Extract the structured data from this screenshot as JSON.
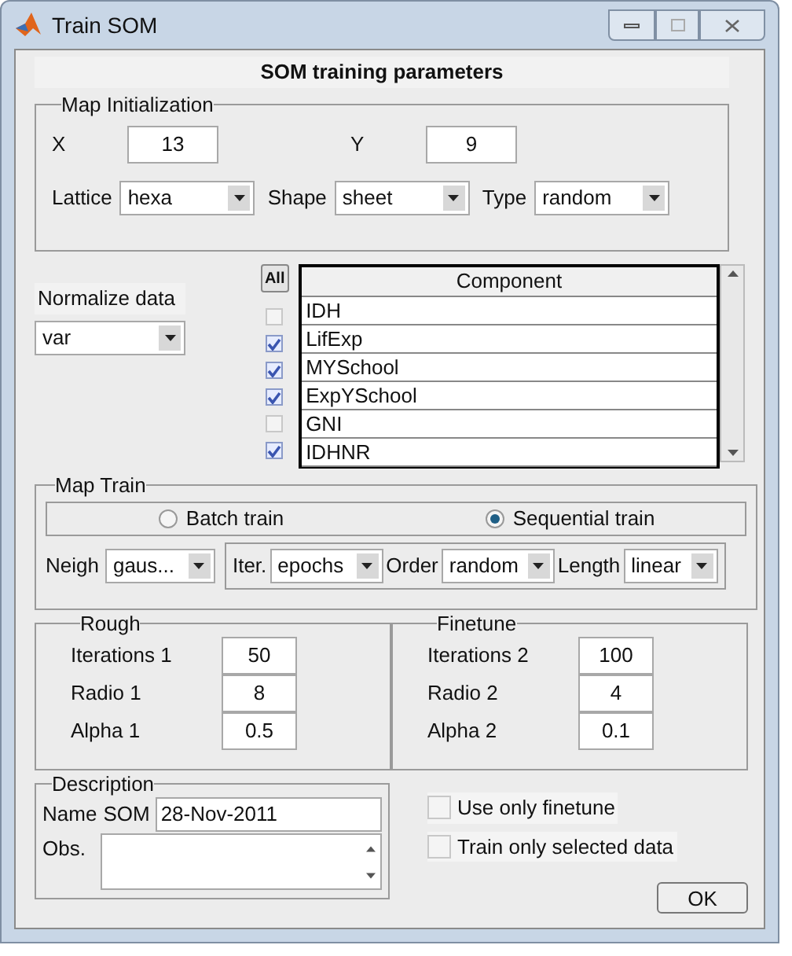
{
  "window": {
    "title": "Train SOM"
  },
  "header": "SOM training parameters",
  "map_initialization": {
    "title": "Map Initialization",
    "fields": [
      {
        "label": "X",
        "value": "13"
      },
      {
        "label": "Y",
        "value": "9"
      }
    ],
    "dropdowns": [
      {
        "label": "Lattice",
        "value": "hexa"
      },
      {
        "label": "Shape",
        "value": "sheet"
      },
      {
        "label": "Type",
        "value": "random"
      }
    ]
  },
  "normalize": {
    "label": "Normalize data",
    "value": "var"
  },
  "components": {
    "all_button": "All",
    "header": "Component",
    "rows": [
      {
        "name": "IDH",
        "checked": false
      },
      {
        "name": "LifExp",
        "checked": true
      },
      {
        "name": "MYSchool",
        "checked": true
      },
      {
        "name": "ExpYSchool",
        "checked": true
      },
      {
        "name": "GNI",
        "checked": false
      },
      {
        "name": "IDHNR",
        "checked": true
      }
    ]
  },
  "map_train": {
    "title": "Map Train",
    "radios": [
      {
        "label": "Batch train",
        "selected": false
      },
      {
        "label": "Sequential train",
        "selected": true
      }
    ],
    "neigh": {
      "label": "Neigh",
      "value": "gaus..."
    },
    "dropdowns": [
      {
        "label": "Iter.",
        "value": "epochs"
      },
      {
        "label": "Order",
        "value": "random"
      },
      {
        "label": "Length",
        "value": "linear"
      }
    ]
  },
  "rough": {
    "title": "Rough",
    "fields": [
      {
        "label": "Iterations 1",
        "value": "50"
      },
      {
        "label": "Radio 1",
        "value": "8"
      },
      {
        "label": "Alpha 1",
        "value": "0.5"
      }
    ]
  },
  "finetune": {
    "title": "Finetune",
    "fields": [
      {
        "label": "Iterations 2",
        "value": "100"
      },
      {
        "label": "Radio 2",
        "value": "4"
      },
      {
        "label": "Alpha 2",
        "value": "0.1"
      }
    ]
  },
  "description": {
    "title": "Description",
    "name_label": "Name",
    "name_prefix": "SOM",
    "name_value": "28-Nov-2011",
    "obs_label": "Obs."
  },
  "options": [
    {
      "label": "Use only finetune",
      "checked": false
    },
    {
      "label": "Train only selected data",
      "checked": false
    }
  ],
  "ok_button": "OK"
}
